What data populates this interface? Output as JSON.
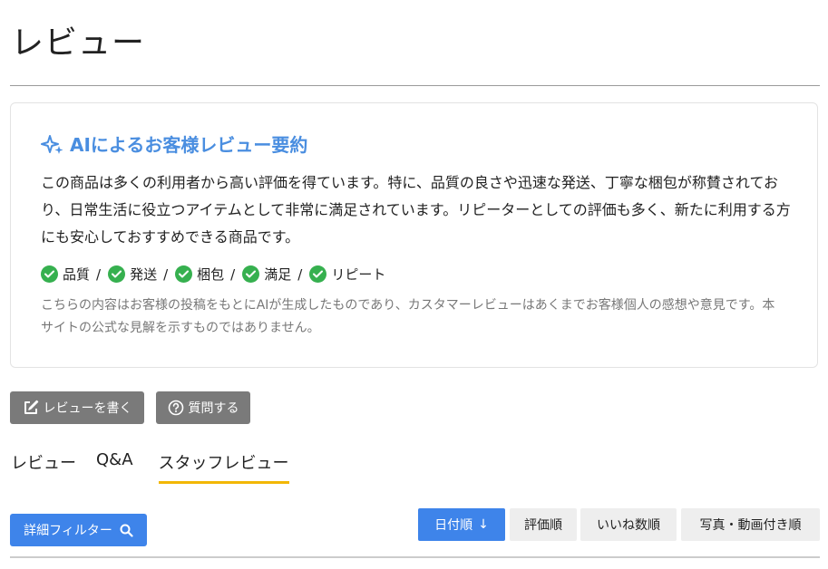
{
  "page": {
    "title": "レビュー"
  },
  "summary": {
    "heading": "AIによるお客様レビュー要約",
    "text": "この商品は多くの利用者から高い評価を得ています。特に、品質の良さや迅速な発送、丁寧な梱包が称賛されており、日常生活に役立つアイテムとして非常に満足されています。リピーターとしての評価も多く、新たに利用する方にも安心しておすすめできる商品です。",
    "tags": [
      "品質",
      "発送",
      "梱包",
      "満足",
      "リピート"
    ],
    "tag_separator": "/",
    "disclaimer": "こちらの内容はお客様の投稿をもとにAIが生成したものであり、カスタマーレビューはあくまでお客様個人の感想や意見です。本サイトの公式な見解を示すものではありません。",
    "heading_color": "#4a8ee0",
    "check_color": "#36b04f"
  },
  "actions": {
    "write_review": "レビューを書く",
    "ask_question": "質問する"
  },
  "tabs": {
    "items": [
      "レビュー",
      "Q&A",
      "スタッフレビュー"
    ],
    "active": "スタッフレビュー",
    "active_color": "#f2b705"
  },
  "filter": {
    "label": "詳細フィルター"
  },
  "sort": {
    "options": [
      "日付順",
      "評価順",
      "いいね数順",
      "写真・動画付き順"
    ],
    "selected": "日付順",
    "selected_arrow": "↓",
    "accent_color": "#3e84ea"
  }
}
